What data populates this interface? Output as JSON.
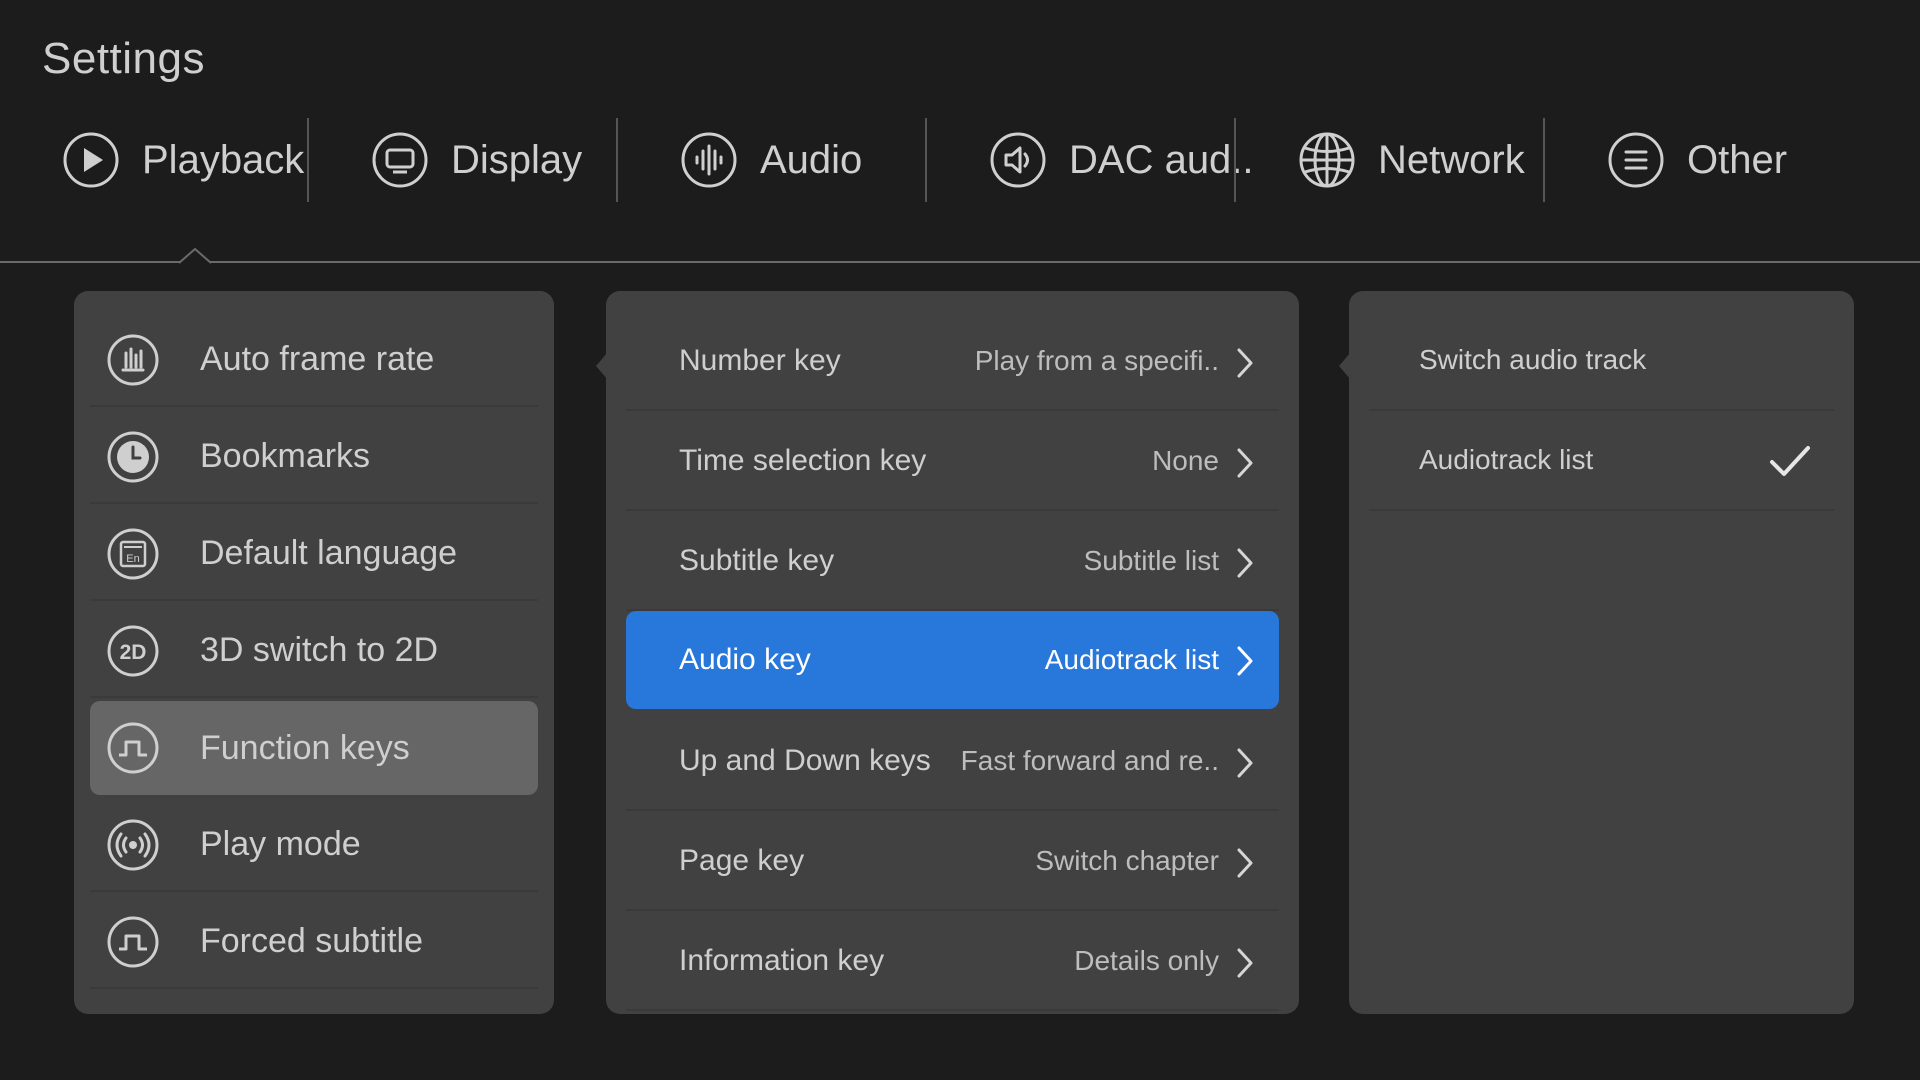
{
  "header": {
    "title": "Settings"
  },
  "tabs": [
    {
      "label": "Playback",
      "icon": "play-icon"
    },
    {
      "label": "Display",
      "icon": "display-icon"
    },
    {
      "label": "Audio",
      "icon": "audio-wave-icon"
    },
    {
      "label": "DAC aud..",
      "icon": "speaker-icon"
    },
    {
      "label": "Network",
      "icon": "globe-icon"
    },
    {
      "label": "Other",
      "icon": "menu-lines-icon"
    }
  ],
  "left_menu": {
    "items": [
      {
        "label": "Auto frame rate",
        "icon": "bar-chart-icon"
      },
      {
        "label": "Bookmarks",
        "icon": "clock-icon"
      },
      {
        "label": "Default language",
        "icon": "language-icon"
      },
      {
        "label": "3D switch to 2D",
        "icon": "2d-icon"
      },
      {
        "label": "Function keys",
        "icon": "pulse-icon",
        "selected": true
      },
      {
        "label": "Play mode",
        "icon": "broadcast-icon"
      },
      {
        "label": "Forced subtitle",
        "icon": "pulse-icon"
      }
    ]
  },
  "function_keys": {
    "items": [
      {
        "label": "Number key",
        "value": "Play from a specifi.."
      },
      {
        "label": "Time selection key",
        "value": "None"
      },
      {
        "label": "Subtitle key",
        "value": "Subtitle list"
      },
      {
        "label": "Audio key",
        "value": "Audiotrack list",
        "selected": true
      },
      {
        "label": "Up and Down keys",
        "value": "Fast forward and re.."
      },
      {
        "label": "Page key",
        "value": "Switch chapter"
      },
      {
        "label": "Information key",
        "value": "Details only"
      }
    ]
  },
  "audio_key_options": {
    "items": [
      {
        "label": "Switch audio track",
        "checked": false
      },
      {
        "label": "Audiotrack list",
        "checked": true
      }
    ]
  },
  "colors": {
    "background": "#1c1c1c",
    "panel": "#414141",
    "accent": "#2878dc",
    "selected_row": "#666666"
  }
}
